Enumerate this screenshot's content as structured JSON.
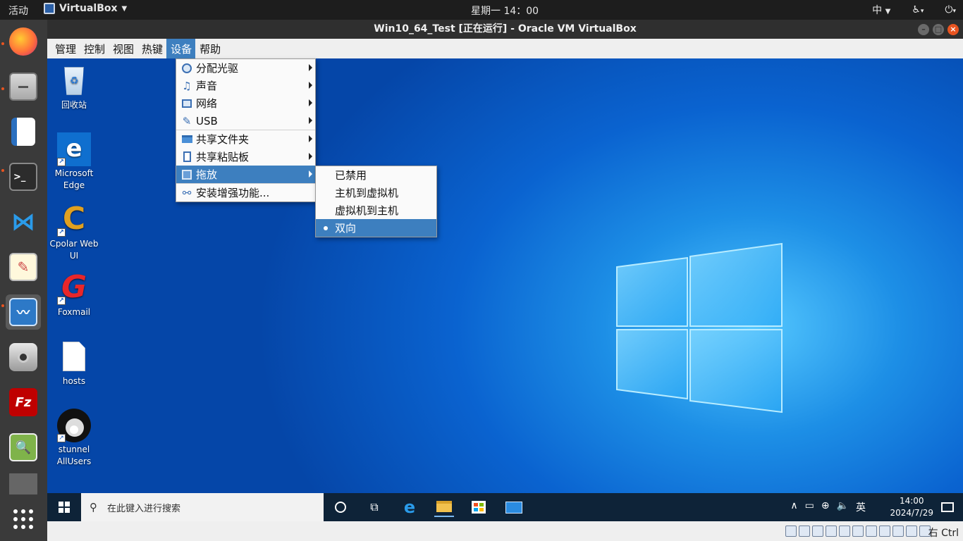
{
  "topbar": {
    "activities": "活动",
    "app_name": "VirtualBox",
    "clock": "星期一 14：00",
    "input_method": "中"
  },
  "window": {
    "title": "Win10_64_Test [正在运行] - Oracle VM VirtualBox"
  },
  "menubar": {
    "items": [
      "管理",
      "控制",
      "视图",
      "热键",
      "设备",
      "帮助"
    ],
    "selected": "设备"
  },
  "devices_menu": {
    "items": [
      {
        "label": "分配光驱",
        "icon": "optical-disc-icon",
        "submenu": true
      },
      {
        "label": "声音",
        "icon": "audio-icon",
        "submenu": true
      },
      {
        "label": "网络",
        "icon": "network-icon",
        "submenu": true
      },
      {
        "label": "USB",
        "icon": "usb-icon",
        "submenu": true
      },
      {
        "label": "共享文件夹",
        "icon": "shared-folder-icon",
        "submenu": true
      },
      {
        "label": "共享粘贴板",
        "icon": "clipboard-icon",
        "submenu": true
      },
      {
        "label": "拖放",
        "icon": "drag-drop-icon",
        "submenu": true,
        "highlighted": true
      },
      {
        "label": "安装增强功能...",
        "icon": "guest-additions-icon",
        "submenu": false
      }
    ]
  },
  "dragdrop_submenu": {
    "items": [
      {
        "label": "已禁用",
        "checked": false
      },
      {
        "label": "主机到虚拟机",
        "checked": false
      },
      {
        "label": "虚拟机到主机",
        "checked": false
      },
      {
        "label": "双向",
        "checked": true
      }
    ]
  },
  "desktop_icons": [
    {
      "label": "回收站",
      "icon": "recycle-bin-icon"
    },
    {
      "label": "Microsoft Edge",
      "icon": "edge-icon"
    },
    {
      "label": "Cpolar Web UI",
      "icon": "cpolar-icon"
    },
    {
      "label": "Foxmail",
      "icon": "foxmail-icon"
    },
    {
      "label": "hosts",
      "icon": "file-icon"
    },
    {
      "label": "stunnel AllUsers",
      "icon": "stunnel-icon"
    }
  ],
  "taskbar": {
    "search_placeholder": "在此键入进行搜索",
    "time": "14:00",
    "date": "2024/7/29",
    "ime": "英"
  },
  "statusbar": {
    "host_key": "右 Ctrl"
  },
  "colors": {
    "menu_highlight": "#3d7fbf",
    "ubuntu_orange": "#e95420",
    "taskbar": "#0e2338"
  }
}
